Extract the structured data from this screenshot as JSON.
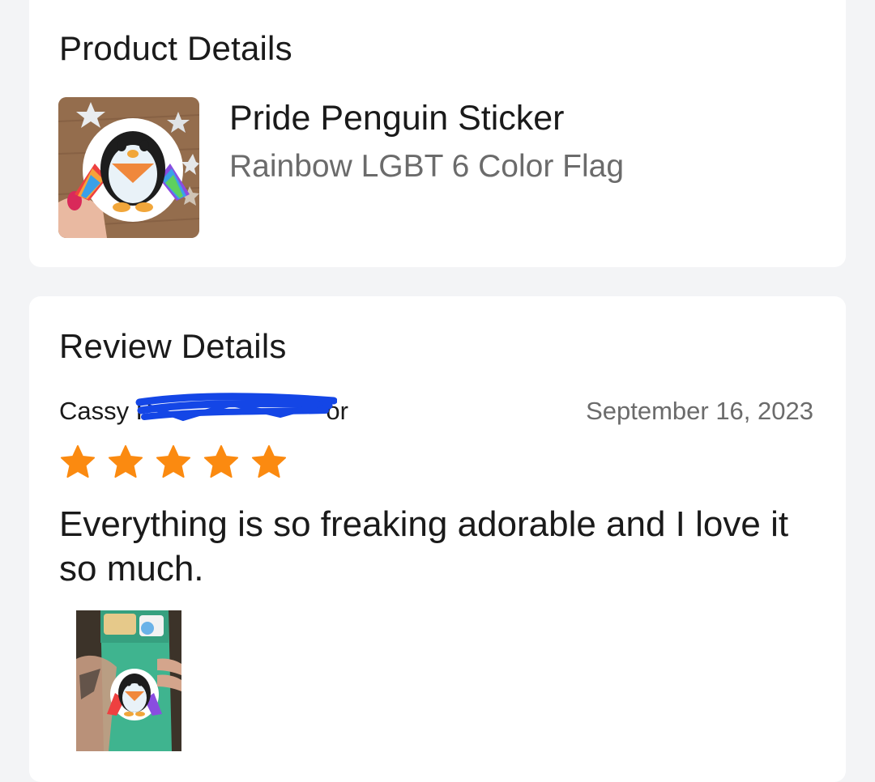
{
  "product_section": {
    "title": "Product Details",
    "product_name": "Pride Penguin Sticker",
    "variant": "Rainbow LGBT 6 Color Flag"
  },
  "review_section": {
    "title": "Review Details",
    "reviewer_name": "Cassy P",
    "reviewer_name_tail": "or",
    "date": "September 16, 2023",
    "rating": 5,
    "rating_max": 5,
    "review_text": "Everything is so freaking adorable and I love it so much.",
    "photo_icon": "penguin-photo-icon"
  },
  "colors": {
    "page_bg": "#f3f4f6",
    "card_bg": "#ffffff",
    "star": "#fb8a10",
    "redaction": "#1446e6",
    "muted_text": "#6b6b6b"
  }
}
